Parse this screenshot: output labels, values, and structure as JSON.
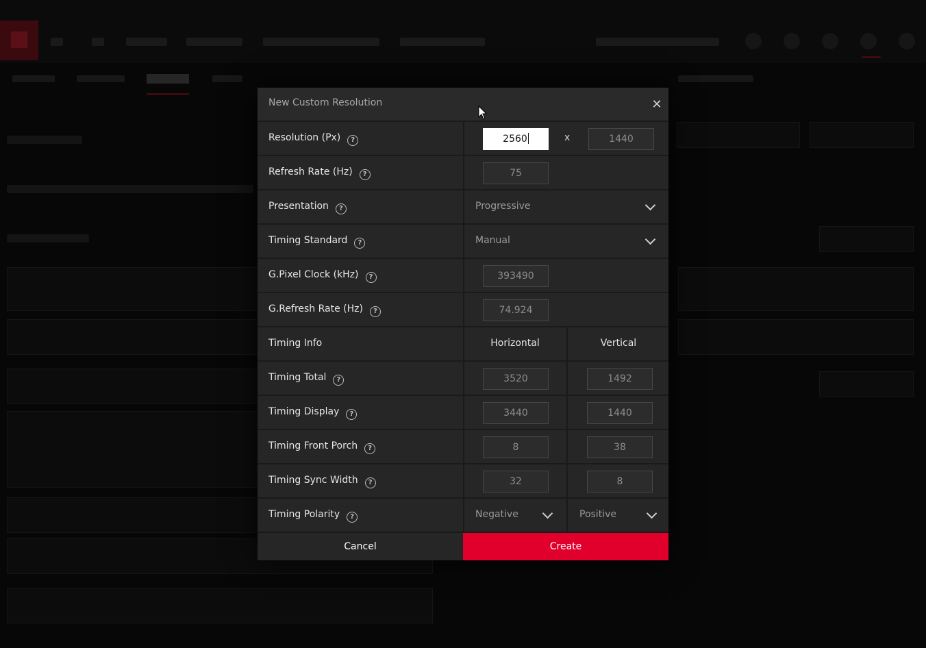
{
  "dialog": {
    "title": "New Custom Resolution",
    "close_icon": "close-icon",
    "cancel_label": "Cancel",
    "create_label": "Create",
    "accent_color": "#e1002c"
  },
  "rows": {
    "resolution": {
      "label": "Resolution (Px)",
      "width": "2560",
      "separator": "x",
      "height": "1440"
    },
    "refresh_rate": {
      "label": "Refresh Rate (Hz)",
      "value": "75"
    },
    "presentation": {
      "label": "Presentation",
      "value": "Progressive"
    },
    "timing_standard": {
      "label": "Timing Standard",
      "value": "Manual"
    },
    "pixel_clock": {
      "label": "G.Pixel Clock (kHz)",
      "value": "393490"
    },
    "g_refresh_rate": {
      "label": "G.Refresh Rate (Hz)",
      "value": "74.924"
    },
    "timing_info": {
      "label": "Timing Info",
      "horizontal": "Horizontal",
      "vertical": "Vertical"
    },
    "timing_total": {
      "label": "Timing Total",
      "h": "3520",
      "v": "1492"
    },
    "timing_display": {
      "label": "Timing Display",
      "h": "3440",
      "v": "1440"
    },
    "timing_front_porch": {
      "label": "Timing Front Porch",
      "h": "8",
      "v": "38"
    },
    "timing_sync_width": {
      "label": "Timing Sync Width",
      "h": "32",
      "v": "8"
    },
    "timing_polarity": {
      "label": "Timing Polarity",
      "h": "Negative",
      "v": "Positive"
    }
  },
  "help_glyph": "?"
}
